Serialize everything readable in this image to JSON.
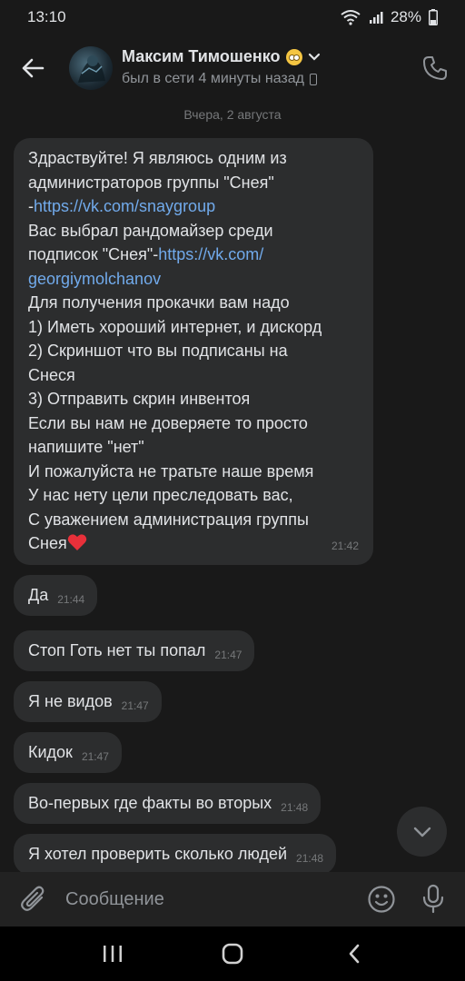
{
  "status_bar": {
    "time": "13:10",
    "battery": "28%",
    "icons": [
      "wifi-icon",
      "signal-icon",
      "battery-icon"
    ]
  },
  "header": {
    "contact_name": "Максим Тимошенко",
    "last_seen": "был в сети 4 минуты назад",
    "icons": [
      "back-arrow-icon",
      "avatar",
      "emoji-icon",
      "chevron-down-icon",
      "phone-status-icon",
      "call-icon"
    ]
  },
  "date_separator": "Вчера, 2 августа",
  "long_message": {
    "lines": [
      "Здраствуйте! Я являюсь одним из",
      "администраторов группы \"Снея\"",
      "-",
      "Вас выбрал рандомайзер среди",
      "подписок \"Снея\"-",
      "",
      "Для получения прокачки вам надо",
      "1) Иметь хороший интернет, и дискорд",
      "2) Скриншот что вы подписаны на",
      "Снеся",
      "3) Отправить скрин инвентоя",
      "Если вы нам не доверяете то просто",
      "напишите \"нет\"",
      "И пожалуйста не тратьте наше время",
      "У нас нету цели преследовать вас,",
      "С уважением администрация группы",
      "Снея"
    ],
    "link1": "https://vk.com/snaygroup",
    "link2_part1": "https://vk.com/",
    "link2_part2": "georgiymolchanov",
    "time": "21:42"
  },
  "messages": [
    {
      "text": "Да",
      "time": "21:44"
    },
    {
      "text": "Стоп Готь нет ты попал",
      "time": "21:47"
    },
    {
      "text": "Я не видов",
      "time": "21:47"
    },
    {
      "text": "Кидок",
      "time": "21:47"
    },
    {
      "text": "Во-первых где факты во вторых",
      "time": "21:48"
    },
    {
      "text": "Я хотел проверить сколько людей",
      "time": "21:48"
    }
  ],
  "composer": {
    "placeholder": "Сообщение"
  },
  "colors": {
    "background": "#191919",
    "bubble": "#2c2d2e",
    "link": "#71aaeb",
    "text": "#e1e3e6",
    "secondary": "#909499"
  }
}
